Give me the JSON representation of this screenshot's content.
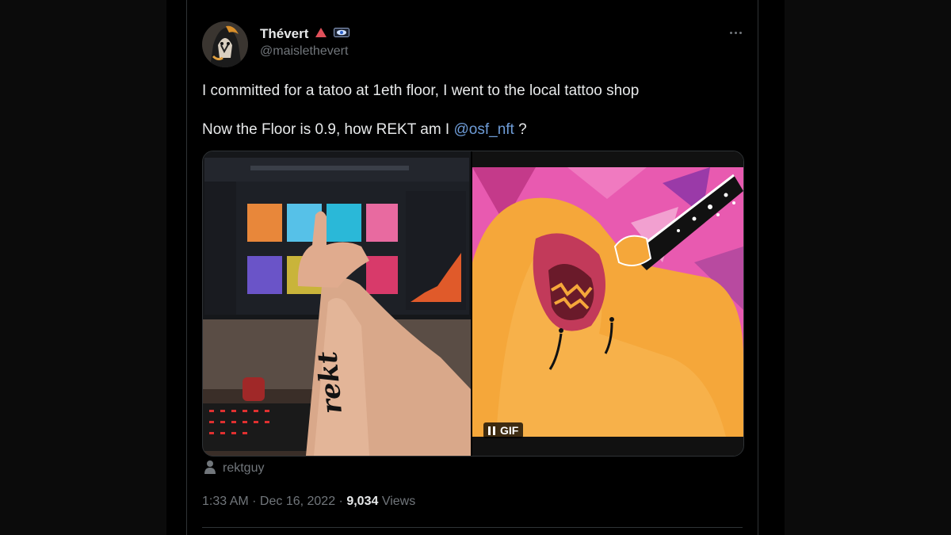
{
  "user": {
    "display_name": "Thévert",
    "handle": "@maislethevert",
    "badge_icon": "red-triangle-icon",
    "badge2_icon": "eye-card-icon"
  },
  "tweet": {
    "line1": "I committed for a tatoo at 1eth floor, I went to the local tattoo shop",
    "line2_prefix": "Now the Floor is 0.9, how REKT am I ",
    "mention": "@osf_nft",
    "line2_suffix": " ?"
  },
  "media": {
    "gif_label": "GIF",
    "tattoo_text": "rekt"
  },
  "tagged_user": "rektguy",
  "meta": {
    "time": "1:33 AM",
    "separator": " · ",
    "date": "Dec 16, 2022",
    "views_count": "9,034",
    "views_label": " Views"
  },
  "colors": {
    "background": "#000000",
    "text": "#e7e9ea",
    "secondary": "#71767b",
    "link": "#6e9cd7",
    "border": "#2f3336"
  }
}
